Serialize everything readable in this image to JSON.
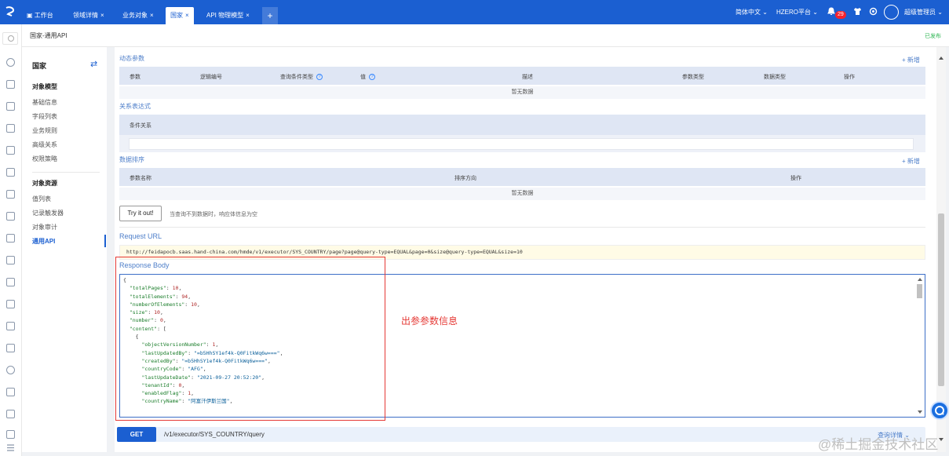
{
  "topbar": {
    "tabs": [
      {
        "label": "工作台",
        "active": false,
        "closable": false
      },
      {
        "label": "领域详情",
        "active": false,
        "closable": true
      },
      {
        "label": "业务对象",
        "active": false,
        "closable": true
      },
      {
        "label": "国家",
        "active": true,
        "closable": true
      },
      {
        "label": "API 物理模型",
        "active": false,
        "closable": true
      }
    ],
    "plus": "+",
    "close_symbol": "×",
    "language": "简体中文 ⌄",
    "platform": "HZERO平台 ⌄",
    "notification_count": "29",
    "user": "超级管理员 ⌄"
  },
  "breadcrumb": "国家-通用API",
  "status": "已发布",
  "left_menu": {
    "title": "国家",
    "swap_icon": "⇄",
    "section1": "对象模型",
    "items1": [
      "基础信息",
      "字段列表",
      "业务规则",
      "高级关系",
      "权限策略"
    ],
    "section2": "对象资源",
    "items2": [
      "值列表",
      "记录触发器",
      "对象审计",
      "通用API"
    ]
  },
  "main": {
    "dynamic_params": {
      "title": "动态参数",
      "add": "+ 新增",
      "headers": [
        "参数",
        "逻辑编号",
        "查询条件类型",
        "值",
        "描述",
        "参数类型",
        "数据类型",
        "操作"
      ],
      "empty": "暂无数据"
    },
    "relation": {
      "title": "关系表达式",
      "header": "条件关系"
    },
    "sort": {
      "title": "数据排序",
      "add": "+ 新增",
      "headers": [
        "参数名称",
        "排序方向",
        "操作"
      ],
      "empty": "暂无数据"
    },
    "try_button": "Try it out!",
    "try_note": "当查询不到数据时，响应体信息为空",
    "request_url_label": "Request URL",
    "request_url": "http://feidapocb.saas.hand-china.com/hmde/v1/executor/SYS_COUNTRY/page?page@query-type=EQUAL&page=0&size@query-type=EQUAL&size=10",
    "response_body_label": "Response Body",
    "annotation": "出参参数信息",
    "get_method": "GET",
    "get_path": "/v1/executor/SYS_COUNTRY/query",
    "get_detail": "查询详情 ⌄"
  },
  "watermark": "@稀土掘金技术社区",
  "colors": {
    "primary": "#1b5fd1",
    "annotation": "#e53935",
    "published": "#2db552"
  }
}
